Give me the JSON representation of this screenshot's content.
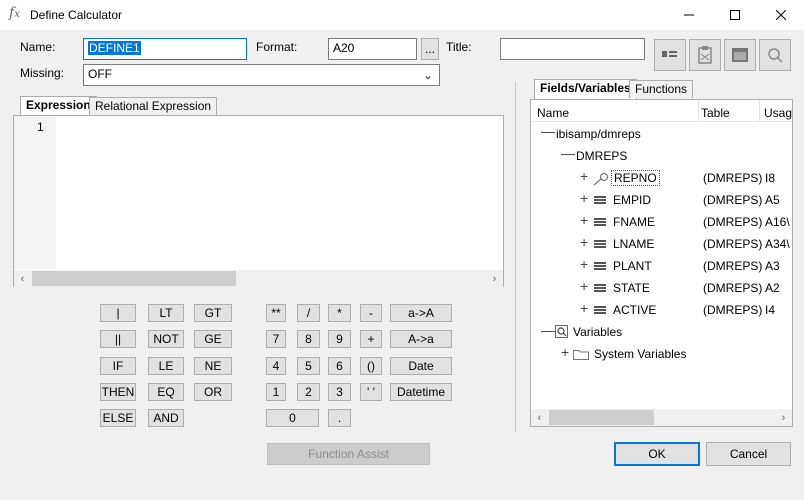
{
  "window": {
    "title": "Define Calculator",
    "icon": "fx-icon"
  },
  "form": {
    "name_label": "Name:",
    "name_value": "DEFINE1",
    "format_label": "Format:",
    "format_value": "A20",
    "format_browse": "...",
    "title_label": "Title:",
    "title_value": "",
    "missing_label": "Missing:",
    "missing_value": "OFF"
  },
  "editor": {
    "tabs": [
      "Expression",
      "Relational Expression"
    ],
    "line_number": "1"
  },
  "keypad": {
    "logical": [
      "|",
      "LT",
      "GT",
      "||",
      "NOT",
      "GE",
      "IF",
      "LE",
      "NE",
      "THEN",
      "EQ",
      "OR",
      "ELSE",
      "AND"
    ],
    "numeric": [
      "**",
      "/",
      "*",
      "-",
      "a->A",
      "7",
      "8",
      "9",
      "+",
      "A->a",
      "4",
      "5",
      "6",
      "()",
      "Date",
      "1",
      "2",
      "3",
      "' '",
      "Datetime",
      "0",
      "."
    ],
    "function_assist": "Function Assist"
  },
  "fields_panel": {
    "tabs": [
      "Fields/Variables",
      "Functions"
    ],
    "columns": [
      "Name",
      "Table",
      "Usag"
    ],
    "root": "ibisamp/dmreps",
    "segment": "DMREPS",
    "fields": [
      {
        "name": "REPNO",
        "table": "(DMREPS)",
        "usage": "I8"
      },
      {
        "name": "EMPID",
        "table": "(DMREPS)",
        "usage": "A5"
      },
      {
        "name": "FNAME",
        "table": "(DMREPS)",
        "usage": "A16\\"
      },
      {
        "name": "LNAME",
        "table": "(DMREPS)",
        "usage": "A34\\"
      },
      {
        "name": "PLANT",
        "table": "(DMREPS)",
        "usage": "A3"
      },
      {
        "name": "STATE",
        "table": "(DMREPS)",
        "usage": "A2"
      },
      {
        "name": "ACTIVE",
        "table": "(DMREPS)",
        "usage": "I4"
      }
    ],
    "variables": "Variables",
    "system_variables": "System Variables"
  },
  "dialog": {
    "ok": "OK",
    "cancel": "Cancel"
  }
}
